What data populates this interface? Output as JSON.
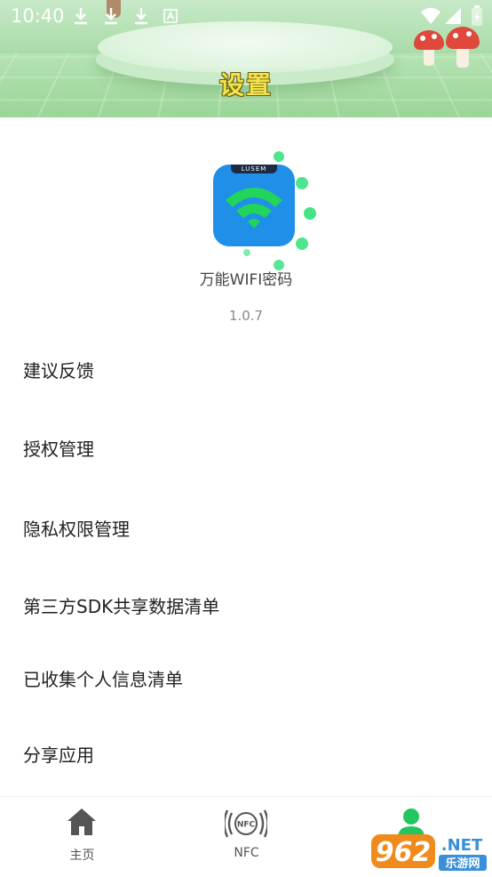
{
  "status_bar": {
    "time": "10:40",
    "icons": [
      "download-icon",
      "download-icon",
      "download-icon",
      "text-a-icon",
      "wifi-icon",
      "signal-icon",
      "battery-icon"
    ]
  },
  "header": {
    "title": "设置"
  },
  "app": {
    "icon_band_text": "LUSEM",
    "name": "万能WIFI密码",
    "version": "1.0.7"
  },
  "menu": {
    "items": [
      {
        "label": "建议反馈"
      },
      {
        "label": "授权管理"
      },
      {
        "label": "隐私权限管理"
      },
      {
        "label": "第三方SDK共享数据清单"
      },
      {
        "label": "已收集个人信息清单"
      },
      {
        "label": "分享应用"
      }
    ]
  },
  "bottom_nav": {
    "items": [
      {
        "label": "主页",
        "icon": "home-icon"
      },
      {
        "label": "NFC",
        "icon": "nfc-icon"
      },
      {
        "label": "",
        "icon": "user-icon"
      }
    ],
    "nfc_icon_text": "NFC"
  },
  "watermark": {
    "number": "962",
    "suffix": ".NET",
    "site": "乐游网"
  },
  "colors": {
    "header_title": "#f2e24a",
    "app_icon_bg": "#1f8fe8",
    "wifi_green": "#22d45a",
    "active_nav": "#22c55e",
    "watermark_orange": "#f08a1c"
  }
}
